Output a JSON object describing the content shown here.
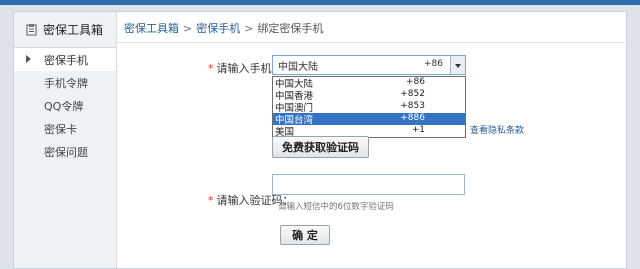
{
  "sidebar": {
    "title": "密保工具箱",
    "items": [
      {
        "label": "密保手机"
      },
      {
        "label": "手机令牌"
      },
      {
        "label": "QQ令牌"
      },
      {
        "label": "密保卡"
      },
      {
        "label": "密保问题"
      }
    ]
  },
  "breadcrumb": {
    "root": "密保工具箱",
    "parent": "密保手机",
    "current": "绑定密保手机",
    "separator": ">"
  },
  "form": {
    "phone_label": "请输入手机号：",
    "required_mark": "*",
    "region_select": {
      "name": "中国大陆",
      "code": "+86"
    },
    "region_options": [
      {
        "name": "中国大陆",
        "code": "+86"
      },
      {
        "name": "中国香港",
        "code": "+852"
      },
      {
        "name": "中国澳门",
        "code": "+853"
      },
      {
        "name": "中国台湾",
        "code": "+886"
      },
      {
        "name": "美国",
        "code": "+1"
      }
    ],
    "privacy_link": "查看隐私条款",
    "get_code_button": "免费获取验证码",
    "code_label": "请输入验证码：",
    "code_hint": "请输入短信中的6位数字验证码",
    "confirm_button": "确 定"
  }
}
